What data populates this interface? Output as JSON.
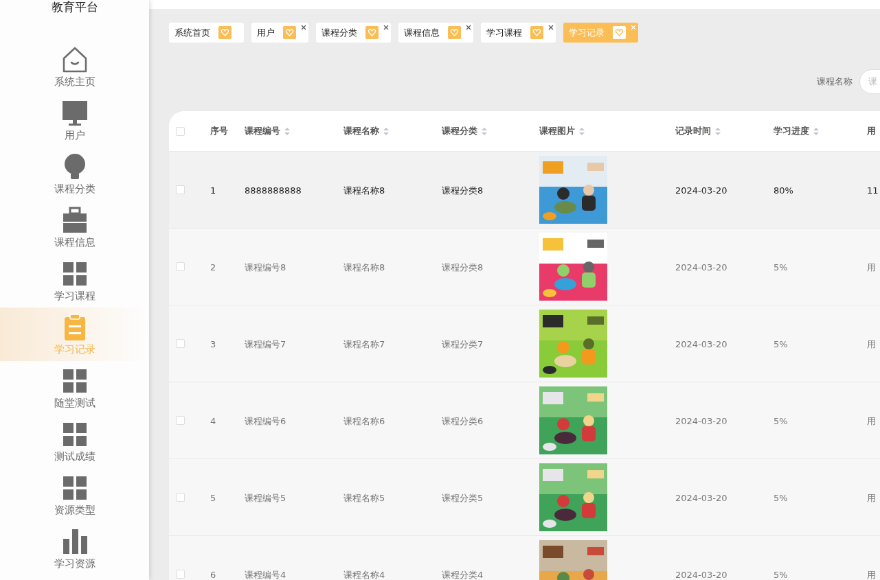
{
  "sidebar": {
    "title": "教育平台",
    "items": [
      {
        "label": "系统主页",
        "selected": false
      },
      {
        "label": "用户",
        "selected": false
      },
      {
        "label": "课程分类",
        "selected": false
      },
      {
        "label": "课程信息",
        "selected": false
      },
      {
        "label": "学习课程",
        "selected": false
      },
      {
        "label": "学习记录",
        "selected": true
      },
      {
        "label": "随堂测试",
        "selected": false
      },
      {
        "label": "测试成绩",
        "selected": false
      },
      {
        "label": "资源类型",
        "selected": false
      },
      {
        "label": "学习资源",
        "selected": false
      }
    ]
  },
  "tabs": [
    {
      "label": "系统首页",
      "selected": false,
      "closable": false
    },
    {
      "label": "用户",
      "selected": false,
      "closable": true
    },
    {
      "label": "课程分类",
      "selected": false,
      "closable": true
    },
    {
      "label": "课程信息",
      "selected": false,
      "closable": true
    },
    {
      "label": "学习课程",
      "selected": false,
      "closable": true
    },
    {
      "label": "学习记录",
      "selected": true,
      "closable": true
    }
  ],
  "search": {
    "label": "课程名称",
    "placeholder": "课"
  },
  "table": {
    "columns": [
      "序号",
      "课程编号",
      "课程名称",
      "课程分类",
      "课程图片",
      "记录时间",
      "学习进度",
      "用"
    ],
    "select_all": {
      "checked": false
    },
    "rows": [
      {
        "checked": false,
        "hovered": true,
        "cells": [
          "1",
          "8888888888",
          "课程名称8",
          "课程分类8",
          {
            "kind": "picture"
          },
          "2024-03-20",
          "80%",
          "11"
        ]
      },
      {
        "checked": false,
        "hovered": false,
        "cells": [
          "2",
          "课程编号8",
          "课程名称8",
          "课程分类8",
          {
            "kind": "picture"
          },
          "2024-03-20",
          "5%",
          "用"
        ]
      },
      {
        "checked": false,
        "hovered": false,
        "cells": [
          "3",
          "课程编号7",
          "课程名称7",
          "课程分类7",
          {
            "kind": "picture"
          },
          "2024-03-20",
          "5%",
          "用"
        ]
      },
      {
        "checked": false,
        "hovered": false,
        "cells": [
          "4",
          "课程编号6",
          "课程名称6",
          "课程分类6",
          {
            "kind": "picture"
          },
          "2024-03-20",
          "5%",
          "用"
        ]
      },
      {
        "checked": false,
        "hovered": false,
        "cells": [
          "5",
          "课程编号5",
          "课程名称5",
          "课程分类5",
          {
            "kind": "picture"
          },
          "2024-03-20",
          "5%",
          "用"
        ]
      },
      {
        "checked": false,
        "hovered": false,
        "cells": [
          "6",
          "课程编号4",
          "课程名称4",
          "课程分类4",
          {
            "kind": "picture"
          },
          "2024-03-20",
          "5%",
          "用"
        ]
      }
    ]
  }
}
